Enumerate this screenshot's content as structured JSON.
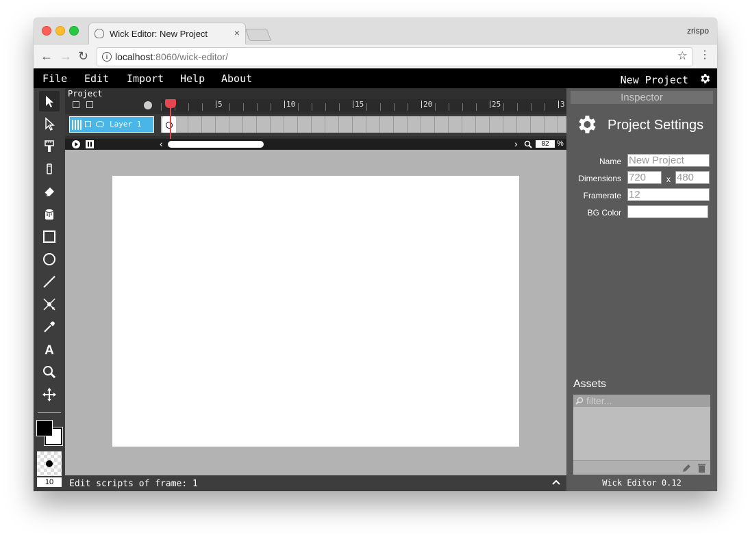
{
  "browser": {
    "tab_title": "Wick Editor: New Project",
    "tab_close": "×",
    "user": "zrispo",
    "url_host": "localhost",
    "url_rest": ":8060/wick-editor/",
    "back": "←",
    "forward": "→",
    "reload": "↻",
    "star": "☆",
    "menu": "⋮",
    "info": "i"
  },
  "menubar": {
    "items": [
      "File",
      "Edit",
      "Import",
      "Help",
      "About"
    ],
    "project_name": "New Project"
  },
  "timeline": {
    "title": "Project",
    "ticks": [
      "5",
      "10",
      "15",
      "20",
      "25",
      "3"
    ],
    "layer_name": "Layer 1",
    "zoom_value": "82",
    "zoom_unit": "%"
  },
  "status": {
    "text_prefix": "Edit scripts of frame: ",
    "frame": "1"
  },
  "tools": {
    "brush_size": "10"
  },
  "inspector": {
    "header": "Inspector",
    "title": "Project Settings",
    "name_label": "Name",
    "name_value": "New Project",
    "dimensions_label": "Dimensions",
    "width": "720",
    "x_sep": "x",
    "height": "480",
    "framerate_label": "Framerate",
    "framerate": "12",
    "bg_label": "BG Color",
    "bg_value": ""
  },
  "assets": {
    "title": "Assets",
    "filter_placeholder": "filter..."
  },
  "footer": {
    "version": "Wick Editor 0.12"
  },
  "colors": {
    "layer_accent": "#4ab6e8",
    "playhead": "#e6464f",
    "menubar": "#000000"
  }
}
